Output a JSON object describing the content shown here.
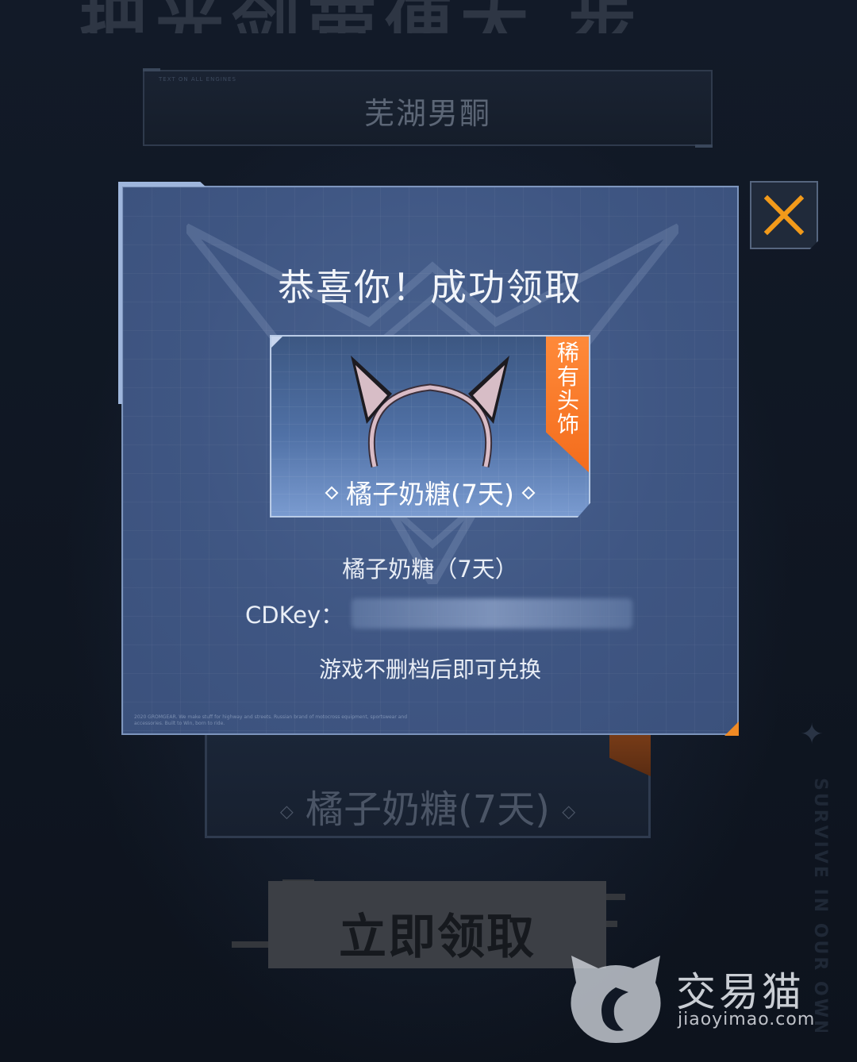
{
  "background": {
    "heading": "把光剑带便大 步",
    "player_name": "芜湖男酮",
    "item_label": "橘子奶糖(7天)",
    "claim_button_label": "立即领取",
    "side_text": "SURVIVE IN OUR OWN WAY"
  },
  "modal": {
    "title": "恭喜你！成功领取",
    "reward_card": {
      "badge": "稀有头饰",
      "item_label": "橘子奶糖(7天)"
    },
    "item_name": "橘子奶糖（7天）",
    "cdkey_label": "CDKey：",
    "cdkey_value": "",
    "redeem_hint": "游戏不删档后即可兑换",
    "fine_print": "2020 GROMGEAR. We make stuff for highway and streets. Russian brand of motocross equipment, sportswear and accessories. Built to Win, born to ride."
  },
  "watermark": {
    "brand_cn": "交易猫",
    "brand_url": "jiaoyimao.com"
  },
  "colors": {
    "modal_bg": "#4a6390",
    "accent_orange": "#f36c1c",
    "close_x": "#f29a1a",
    "page_bg": "#0e141f"
  },
  "icons": {
    "close": "close-icon",
    "item": "cat-ear-headband-icon",
    "logo": "cat-logo-icon"
  }
}
